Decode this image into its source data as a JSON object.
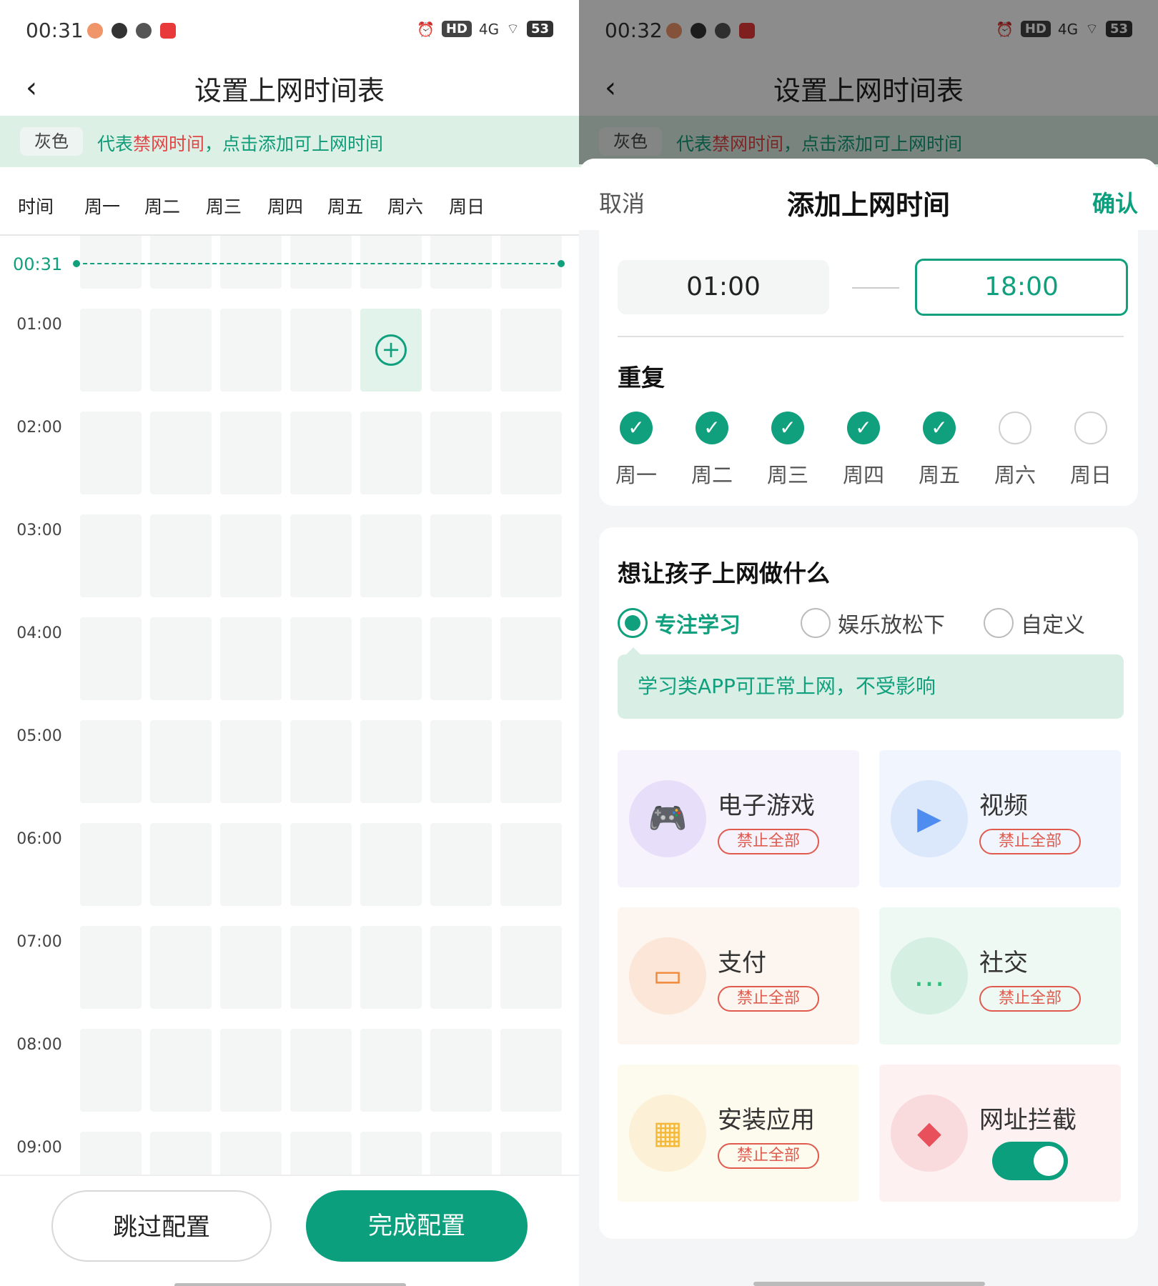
{
  "left": {
    "status": {
      "time": "00:31",
      "battery": "53",
      "network": "4G",
      "hd": "HD"
    },
    "title": "设置上网时间表",
    "hint": {
      "chip": "灰色",
      "part1": "代表",
      "red": "禁网时间",
      "part2": "，点击添加可上网时间"
    },
    "days": [
      "时间",
      "周一",
      "周二",
      "周三",
      "周四",
      "周五",
      "周六",
      "周日"
    ],
    "now_label": "00:31",
    "times": [
      "01:00",
      "02:00",
      "03:00",
      "04:00",
      "05:00",
      "06:00",
      "07:00",
      "08:00",
      "09:00"
    ],
    "active_cell": {
      "hour": "01:00",
      "day": "周五"
    },
    "skip_label": "跳过配置",
    "done_label": "完成配置"
  },
  "right": {
    "status": {
      "time": "00:32",
      "battery": "53",
      "network": "4G",
      "hd": "HD"
    },
    "title": "设置上网时间表",
    "hint": {
      "chip": "灰色",
      "part1": "代表",
      "red": "禁网时间",
      "part2": "，点击添加可上网时间"
    },
    "sheet": {
      "cancel": "取消",
      "title": "添加上网时间",
      "confirm": "确认",
      "start_time": "01:00",
      "end_time": "18:00",
      "repeat_label": "重复",
      "repeat_days": [
        {
          "name": "周一",
          "checked": true
        },
        {
          "name": "周二",
          "checked": true
        },
        {
          "name": "周三",
          "checked": true
        },
        {
          "name": "周四",
          "checked": true
        },
        {
          "name": "周五",
          "checked": true
        },
        {
          "name": "周六",
          "checked": false
        },
        {
          "name": "周日",
          "checked": false
        }
      ],
      "purpose_title": "想让孩子上网做什么",
      "options": [
        {
          "label": "专注学习",
          "selected": true
        },
        {
          "label": "娱乐放松下",
          "selected": false
        },
        {
          "label": "自定义",
          "selected": false
        }
      ],
      "tip": "学习类APP可正常上网，不受影响",
      "tiles": [
        {
          "name": "电子游戏",
          "badge": "禁止全部",
          "icon": "gamepad-icon",
          "color": "#8a63e8"
        },
        {
          "name": "视频",
          "badge": "禁止全部",
          "icon": "video-icon",
          "color": "#4f8cf0"
        },
        {
          "name": "支付",
          "badge": "禁止全部",
          "icon": "wallet-icon",
          "color": "#f08a3c"
        },
        {
          "name": "社交",
          "badge": "禁止全部",
          "icon": "chat-icon",
          "color": "#2fbf7a"
        },
        {
          "name": "安装应用",
          "badge": "禁止全部",
          "icon": "apps-icon",
          "color": "#f5b93a"
        },
        {
          "name": "网址拦截",
          "toggle": true,
          "icon": "shield-icon",
          "color": "#e8505b"
        }
      ]
    }
  },
  "colors": {
    "accent": "#0c9f7e",
    "forbid_red": "#e04848"
  }
}
